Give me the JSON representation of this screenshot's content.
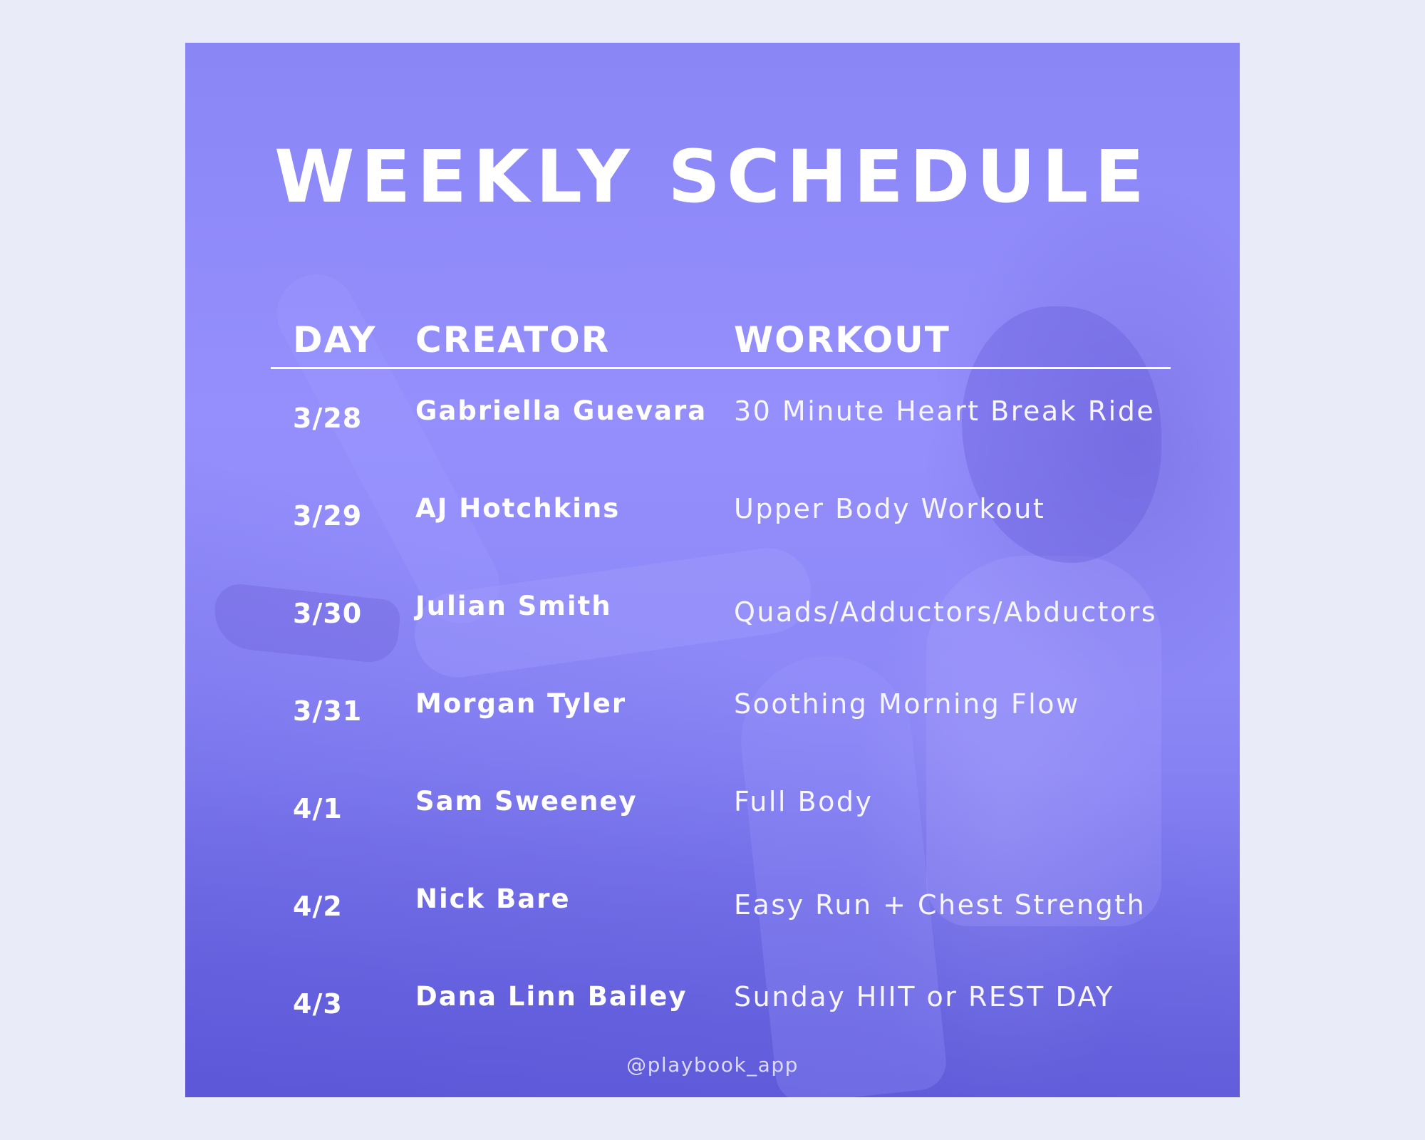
{
  "page": {
    "background_color": "#eaebf9",
    "card_overlay_color": "#8b87f5"
  },
  "title": "WEEKLY SCHEDULE",
  "table": {
    "headers": {
      "day": "DAY",
      "creator": "CREATOR",
      "workout": "WORKOUT"
    },
    "rows": [
      {
        "day": "3/28",
        "creator": "Gabriella Guevara",
        "workout": "30 Minute Heart Break Ride"
      },
      {
        "day": "3/29",
        "creator": "AJ Hotchkins",
        "workout": "Upper Body Workout"
      },
      {
        "day": "3/30",
        "creator": "Julian Smith",
        "workout": "Quads/Adductors/Abductors"
      },
      {
        "day": "3/31",
        "creator": "Morgan Tyler",
        "workout": "Soothing Morning Flow"
      },
      {
        "day": "4/1",
        "creator": "Sam Sweeney",
        "workout": "Full Body"
      },
      {
        "day": "4/2",
        "creator": "Nick Bare",
        "workout": "Easy Run + Chest Strength"
      },
      {
        "day": "4/3",
        "creator": "Dana Linn Bailey",
        "workout": "Sunday HIIT or REST DAY"
      }
    ]
  },
  "footer": {
    "handle": "@playbook_app"
  },
  "background_image": {
    "description": "woman in boat yoga pose, purple tinted"
  }
}
